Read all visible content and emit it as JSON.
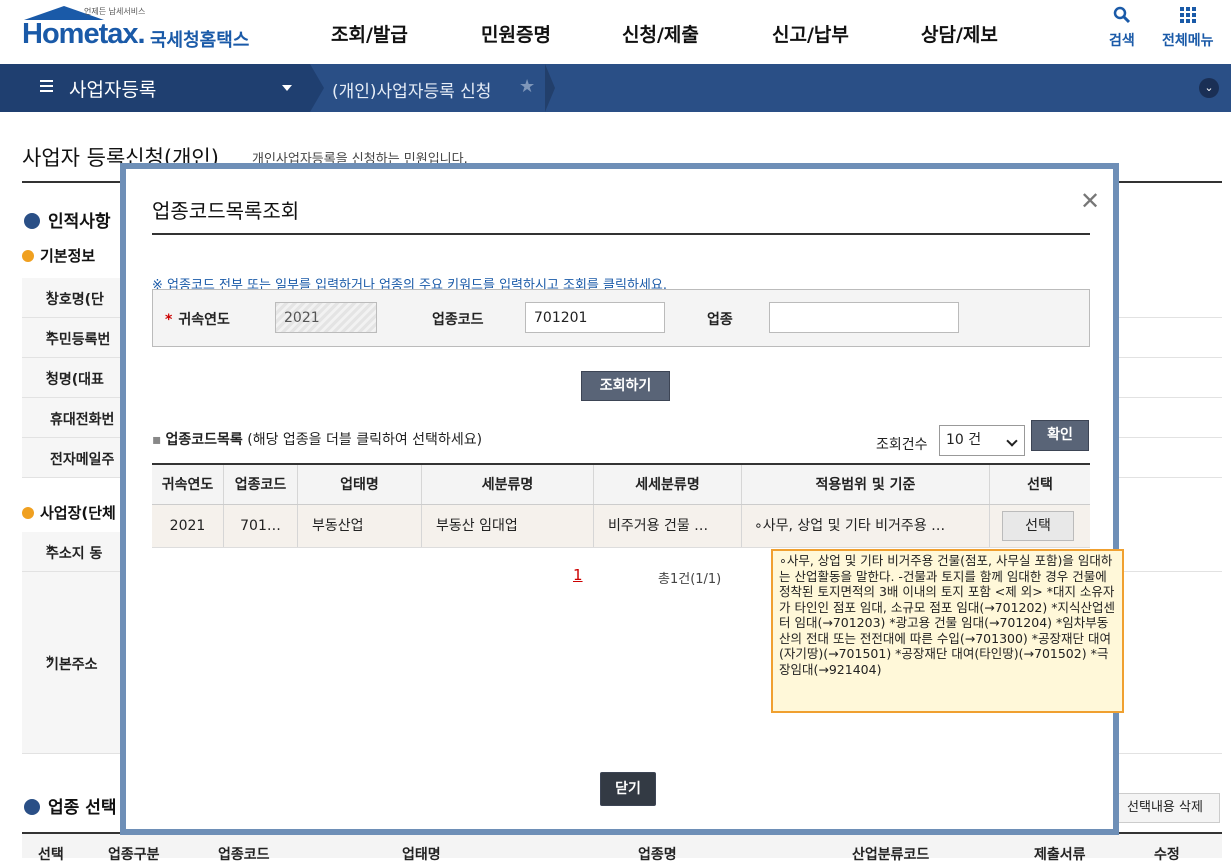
{
  "header": {
    "logo": {
      "sub": "언제든 납세서비스",
      "main": "Hometax.",
      "kr": "국세청홈택스"
    },
    "gnb": [
      "조회/발급",
      "민원증명",
      "신청/제출",
      "신고/납부",
      "상담/제보"
    ],
    "util": {
      "search": "검색",
      "all_menu": "전체메뉴"
    }
  },
  "locbar": {
    "menu": "사업자등록",
    "crumb": "(개인)사업자등록 신청"
  },
  "page": {
    "title": "사업자 등록신청(개인)",
    "desc": "개인사업자등록을 신청하는 민원입니다.",
    "sec1": "인적사항",
    "basic": "기본정보",
    "rows": [
      "상호명(단",
      "주민등록번",
      "성명(대표",
      "휴대전화번",
      "전자메일주"
    ],
    "biz": "사업장(단체",
    "addr_rows": [
      "주소지 동",
      "기본주소"
    ],
    "sec2": "업종 선택",
    "del_btn": "선택내용 삭제",
    "under_cols": [
      "선택",
      "업종구분",
      "업종코드",
      "업태명",
      "업종명",
      "산업분류코드",
      "제출서류",
      "수정"
    ]
  },
  "modal": {
    "title": "업종코드목록조회",
    "notice": "※ 업종코드 전부 또는 일부를 입력하거나 업종의 주요 키워드를 입력하시고 조회를 클릭하세요.",
    "fields": {
      "year_label": "귀속연도",
      "year_value": "2021",
      "code_label": "업종코드",
      "code_value": "701201",
      "name_label": "업종",
      "name_value": ""
    },
    "search_btn": "조회하기",
    "list_title": "업종코드목록",
    "list_hint": "(해당 업종을 더블 클릭하여 선택하세요)",
    "count_label": "조회건수",
    "count_value": "10 건",
    "confirm_btn": "확인",
    "columns": [
      "귀속연도",
      "업종코드",
      "업태명",
      "세분류명",
      "세세분류명",
      "적용범위 및 기준",
      "선택"
    ],
    "rows": [
      {
        "year": "2021",
        "code": "701…",
        "biz_type": "부동산업",
        "sub_class": "부동산 임대업",
        "detail_class": "비주거용 건물 …",
        "scope": "∘사무, 상업 및 기타 비거주용 …",
        "select": "선택"
      }
    ],
    "pager": {
      "page": "1",
      "total": "총1건(1/1)"
    },
    "tooltip": "∘사무, 상업 및 기타 비거주용 건물(점포, 사무실 포함)을 임대하는 산업활동을 말한다. -건물과 토지를 함께 임대한 경우 건물에 정착된 토지면적의 3배 이내의 토지 포함 <제 외> *대지 소유자가 타인인 점포 임대, 소규모 점포 임대(→701202) *지식산업센터 임대(→701203) *광고용 건물 임대(→701204) *임차부동산의 전대 또는 전전대에 따른 수입(→701300) *공장재단 대여(자기땅)(→701501) *공장재단 대여(타인땅)(→701502) *극장임대(→921404)",
    "close_btn": "닫기"
  },
  "colors": {
    "brand": "#1a5aa8",
    "locbar": "#2a4f86",
    "modal_border": "#6e8fb7",
    "tooltip_bg": "#fff8d9",
    "tooltip_border": "#f0a030"
  }
}
